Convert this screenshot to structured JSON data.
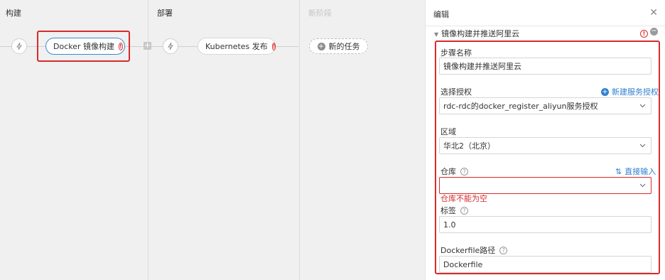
{
  "stages": {
    "build": {
      "title": "构建",
      "job": "Docker 镜像构建"
    },
    "deploy": {
      "title": "部署",
      "job": "Kubernetes 发布"
    },
    "new_stage": {
      "title": "新阶段",
      "new_task": "新的任务"
    }
  },
  "panel": {
    "title": "编辑",
    "section_title": "镜像构建并推送阿里云",
    "fields": {
      "step_name": {
        "label": "步骤名称",
        "value": "镜像构建并推送阿里云"
      },
      "auth": {
        "label": "选择授权",
        "value": "rdc-rdc的docker_register_aliyun服务授权",
        "link": "新建服务授权"
      },
      "region": {
        "label": "区域",
        "value": "华北2（北京）"
      },
      "repo": {
        "label": "仓库",
        "value": "",
        "link": "直接输入",
        "error": "仓库不能为空"
      },
      "tag": {
        "label": "标签",
        "value": "1.0"
      },
      "dockerfile": {
        "label": "Dockerfile路径",
        "value": "Dockerfile"
      }
    }
  },
  "colors": {
    "accent": "#3b88d6",
    "error": "#d72b2b",
    "link": "#2f7fd1"
  }
}
